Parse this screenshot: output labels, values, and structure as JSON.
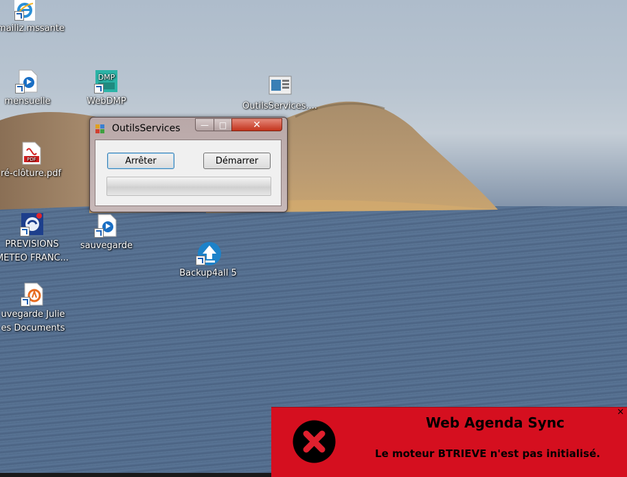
{
  "desktop": {
    "icons": [
      {
        "label": "mailiz.mssante"
      },
      {
        "label": "mensuelle"
      },
      {
        "label": "WebDMP"
      },
      {
        "label": "OutilsServices...."
      },
      {
        "label": "ré-clôture.pdf"
      },
      {
        "label_line1": "PREVISIONS",
        "label_line2": "METEO FRANC..."
      },
      {
        "label": "sauvegarde"
      },
      {
        "label": "Backup4all 5"
      },
      {
        "label_line1": "uvegarde Julie",
        "label_line2": "es Documents"
      }
    ],
    "icon_names": [
      "internet-explorer-icon",
      "shortcut-icon",
      "webdmp-icon",
      "outilsservices-icon",
      "pdf-icon",
      "meteo-icon",
      "backup-icon",
      "backup4all-icon",
      "backup-julie-icon"
    ],
    "colors": {
      "sea": "#55708f",
      "sky": "#b8c4d0",
      "hill": "#b89a72"
    }
  },
  "window": {
    "title": "OutilsServices",
    "buttons": {
      "stop_label": "Arrêter",
      "start_label": "Démarrer"
    },
    "progress_value": 0,
    "caption": {
      "minimize": "—",
      "maximize": "□",
      "close": "✕"
    }
  },
  "toast": {
    "title": "Web Agenda Sync",
    "message": "Le moteur BTRIEVE n'est pas initialisé.",
    "close": "×",
    "icon": "error-icon",
    "background": "#d50f1f"
  }
}
